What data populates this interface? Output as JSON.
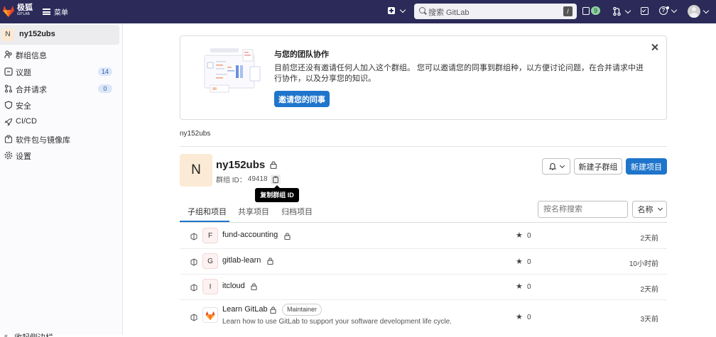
{
  "topbar": {
    "brand": "极狐",
    "brand_sub": "GITLAB",
    "menu_label": "菜单",
    "search_placeholder": "搜索 GitLab",
    "search_shortcut": "/",
    "issues_count": "9"
  },
  "sidebar": {
    "group_initial": "N",
    "group_name": "ny152ubs",
    "items": [
      {
        "label": "群组信息",
        "icon": "group-info-icon"
      },
      {
        "label": "议题",
        "icon": "issues-icon",
        "count": "14"
      },
      {
        "label": "合并请求",
        "icon": "merge-request-icon",
        "count": "0"
      },
      {
        "label": "安全",
        "icon": "shield-icon"
      },
      {
        "label": "CI/CD",
        "icon": "rocket-icon"
      },
      {
        "label": "软件包与镜像库",
        "icon": "package-icon"
      },
      {
        "label": "设置",
        "icon": "gear-icon"
      }
    ],
    "bottom_partial": "收起侧边栏"
  },
  "banner": {
    "title": "与您的团队协作",
    "body": "目前您还没有邀请任何人加入这个群组。 您可以邀请您的同事到群组种，以方便讨论问题，在合并请求中进行协作，以及分享您的知识。",
    "button": "邀请您的同事"
  },
  "breadcrumb": "ny152ubs",
  "group": {
    "initial": "N",
    "name": "ny152ubs",
    "id_label": "群组 ID：",
    "id": "49418",
    "tooltip": "复制群组 ID",
    "new_subgroup": "新建子群组",
    "new_project": "新建项目"
  },
  "tabs": [
    "子组和项目",
    "共享项目",
    "归档项目"
  ],
  "filter": {
    "placeholder": "按名称搜索",
    "sort": "名称"
  },
  "projects": [
    {
      "initial": "F",
      "name": "fund-accounting",
      "stars": "0",
      "updated": "2天前"
    },
    {
      "initial": "G",
      "name": "gitlab-learn",
      "stars": "0",
      "updated": "10小时前"
    },
    {
      "initial": "I",
      "name": "itcloud",
      "stars": "0",
      "updated": "2天前"
    },
    {
      "initial": "",
      "name": "Learn GitLab",
      "badge": "Maintainer",
      "description": "Learn how to use GitLab to support your software development life cycle.",
      "stars": "0",
      "updated": "3天前"
    }
  ],
  "colors": {
    "topbar": "#2b2a59",
    "primary": "#1f75cb",
    "tab_active": "#1f75cb",
    "tooltip": "#000000"
  }
}
